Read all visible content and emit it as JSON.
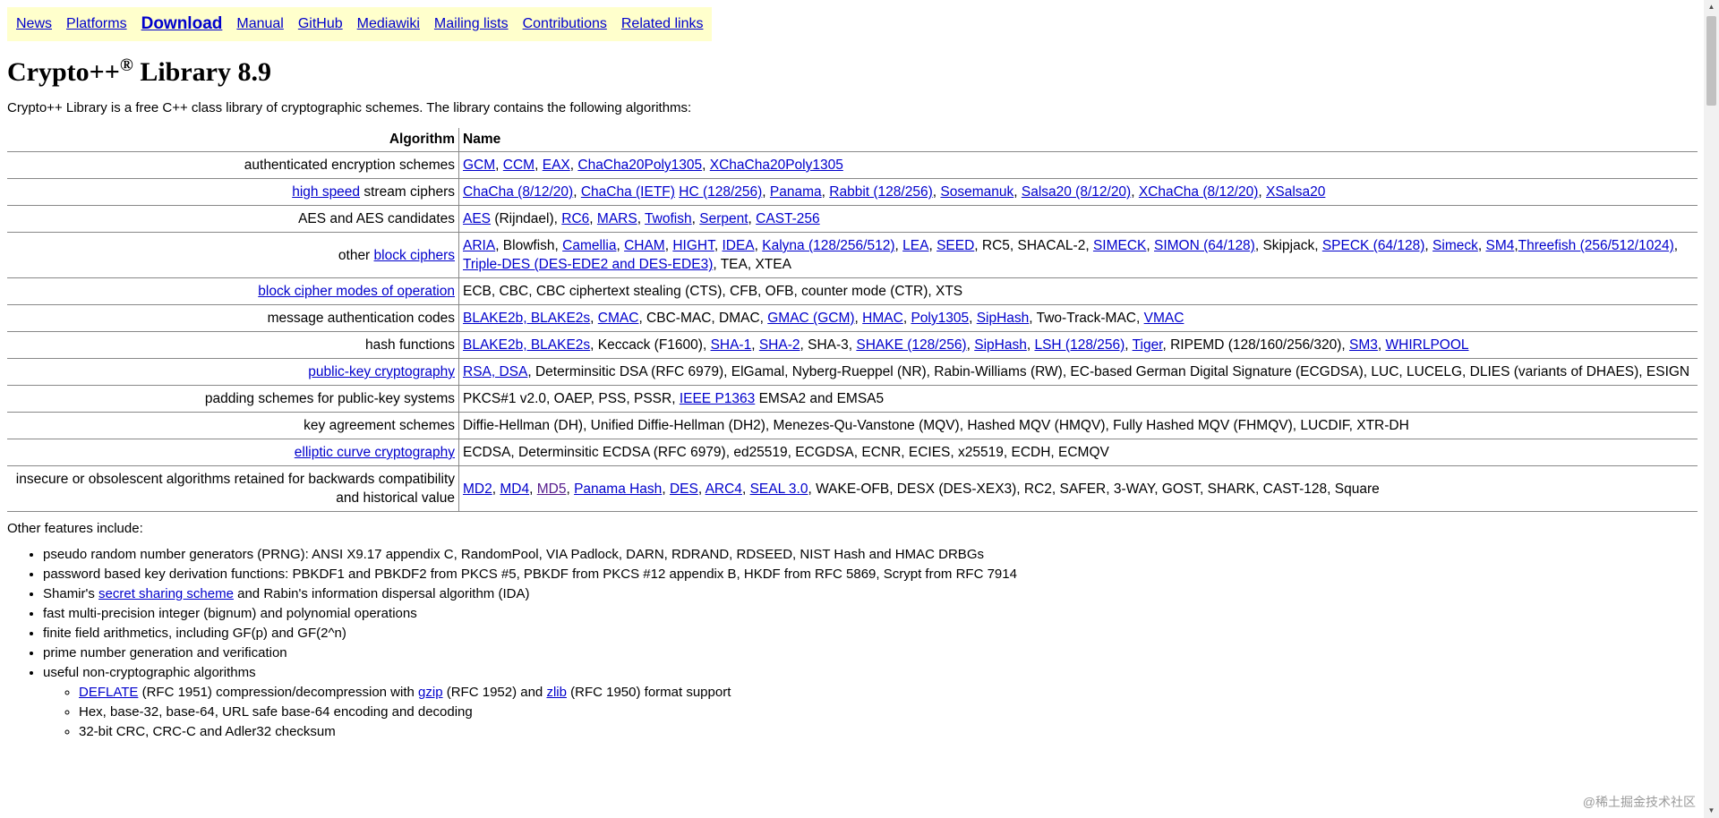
{
  "nav": [
    {
      "label": "News",
      "strong": false
    },
    {
      "label": "Platforms",
      "strong": false
    },
    {
      "label": "Download",
      "strong": true
    },
    {
      "label": "Manual",
      "strong": false
    },
    {
      "label": "GitHub",
      "strong": false
    },
    {
      "label": "Mediawiki",
      "strong": false
    },
    {
      "label": "Mailing lists",
      "strong": false
    },
    {
      "label": "Contributions",
      "strong": false
    },
    {
      "label": "Related links",
      "strong": false
    }
  ],
  "title": {
    "main": "Crypto++",
    "sup": "®",
    "suffix": " Library 8.9"
  },
  "intro": "Crypto++ Library is a free C++ class library of cryptographic schemes. The library contains the following algorithms:",
  "table": {
    "headers": [
      "Algorithm",
      "Name"
    ],
    "rows": [
      {
        "left": [
          {
            "t": "authenticated encryption schemes"
          }
        ],
        "right": [
          {
            "t": "GCM",
            "l": true
          },
          {
            "t": ", "
          },
          {
            "t": "CCM",
            "l": true
          },
          {
            "t": ", "
          },
          {
            "t": "EAX",
            "l": true
          },
          {
            "t": ", "
          },
          {
            "t": "ChaCha20Poly1305",
            "l": true
          },
          {
            "t": ", "
          },
          {
            "t": "XChaCha20Poly1305",
            "l": true
          }
        ]
      },
      {
        "left": [
          {
            "t": "high speed",
            "l": true
          },
          {
            "t": " stream ciphers"
          }
        ],
        "right": [
          {
            "t": "ChaCha (8/12/20)",
            "l": true
          },
          {
            "t": ", "
          },
          {
            "t": "ChaCha (IETF)",
            "l": true
          },
          {
            "t": " "
          },
          {
            "t": "HC (128/256)",
            "l": true
          },
          {
            "t": ", "
          },
          {
            "t": "Panama",
            "l": true
          },
          {
            "t": ", "
          },
          {
            "t": "Rabbit (128/256)",
            "l": true
          },
          {
            "t": ", "
          },
          {
            "t": "Sosemanuk",
            "l": true
          },
          {
            "t": ", "
          },
          {
            "t": "Salsa20 (8/12/20)",
            "l": true
          },
          {
            "t": ", "
          },
          {
            "t": "XChaCha (8/12/20)",
            "l": true
          },
          {
            "t": ", "
          },
          {
            "t": "XSalsa20",
            "l": true
          }
        ]
      },
      {
        "left": [
          {
            "t": "AES and AES candidates"
          }
        ],
        "right": [
          {
            "t": "AES",
            "l": true
          },
          {
            "t": " (Rijndael), "
          },
          {
            "t": "RC6",
            "l": true
          },
          {
            "t": ", "
          },
          {
            "t": "MARS",
            "l": true
          },
          {
            "t": ", "
          },
          {
            "t": "Twofish",
            "l": true
          },
          {
            "t": ", "
          },
          {
            "t": "Serpent",
            "l": true
          },
          {
            "t": ", "
          },
          {
            "t": "CAST-256",
            "l": true
          }
        ]
      },
      {
        "left": [
          {
            "t": "other "
          },
          {
            "t": "block ciphers",
            "l": true
          }
        ],
        "right": [
          {
            "t": "ARIA",
            "l": true
          },
          {
            "t": ", Blowfish, "
          },
          {
            "t": "Camellia",
            "l": true
          },
          {
            "t": ", "
          },
          {
            "t": "CHAM",
            "l": true
          },
          {
            "t": ", "
          },
          {
            "t": "HIGHT",
            "l": true
          },
          {
            "t": ", "
          },
          {
            "t": "IDEA",
            "l": true
          },
          {
            "t": ", "
          },
          {
            "t": "Kalyna (128/256/512)",
            "l": true
          },
          {
            "t": ", "
          },
          {
            "t": "LEA",
            "l": true
          },
          {
            "t": ", "
          },
          {
            "t": "SEED",
            "l": true
          },
          {
            "t": ", RC5, SHACAL-2, "
          },
          {
            "t": "SIMECK",
            "l": true
          },
          {
            "t": ", "
          },
          {
            "t": "SIMON (64/128)",
            "l": true
          },
          {
            "t": ", Skipjack, "
          },
          {
            "t": "SPECK (64/128)",
            "l": true
          },
          {
            "t": ", "
          },
          {
            "t": "Simeck",
            "l": true
          },
          {
            "t": ", "
          },
          {
            "t": "SM4",
            "l": true
          },
          {
            "t": ","
          },
          {
            "t": "Threefish (256/512/1024)",
            "l": true
          },
          {
            "t": ", "
          },
          {
            "t": "Triple-DES (DES-EDE2 and DES-EDE3)",
            "l": true
          },
          {
            "t": ", TEA, XTEA"
          }
        ]
      },
      {
        "left": [
          {
            "t": "block cipher modes of operation",
            "l": true
          }
        ],
        "right": [
          {
            "t": "ECB, CBC, CBC ciphertext stealing (CTS), CFB, OFB, counter mode (CTR), XTS"
          }
        ]
      },
      {
        "left": [
          {
            "t": "message authentication codes"
          }
        ],
        "right": [
          {
            "t": "BLAKE2b, BLAKE2s",
            "l": true
          },
          {
            "t": ", "
          },
          {
            "t": "CMAC",
            "l": true
          },
          {
            "t": ", CBC-MAC, DMAC, "
          },
          {
            "t": "GMAC (GCM)",
            "l": true
          },
          {
            "t": ", "
          },
          {
            "t": "HMAC",
            "l": true
          },
          {
            "t": ", "
          },
          {
            "t": "Poly1305",
            "l": true
          },
          {
            "t": ", "
          },
          {
            "t": "SipHash",
            "l": true
          },
          {
            "t": ", Two-Track-MAC, "
          },
          {
            "t": "VMAC",
            "l": true
          }
        ]
      },
      {
        "left": [
          {
            "t": "hash functions"
          }
        ],
        "right": [
          {
            "t": "BLAKE2b, BLAKE2s",
            "l": true
          },
          {
            "t": ", Keccack (F1600), "
          },
          {
            "t": "SHA-1",
            "l": true
          },
          {
            "t": ", "
          },
          {
            "t": "SHA-2",
            "l": true
          },
          {
            "t": ", SHA-3, "
          },
          {
            "t": "SHAKE (128/256)",
            "l": true
          },
          {
            "t": ", "
          },
          {
            "t": "SipHash",
            "l": true
          },
          {
            "t": ", "
          },
          {
            "t": "LSH (128/256)",
            "l": true
          },
          {
            "t": ", "
          },
          {
            "t": "Tiger",
            "l": true
          },
          {
            "t": ", RIPEMD (128/160/256/320), "
          },
          {
            "t": "SM3",
            "l": true
          },
          {
            "t": ", "
          },
          {
            "t": "WHIRLPOOL",
            "l": true
          }
        ]
      },
      {
        "left": [
          {
            "t": "public-key cryptography",
            "l": true
          }
        ],
        "right": [
          {
            "t": "RSA, DSA",
            "l": true
          },
          {
            "t": ", Determinsitic DSA (RFC 6979), ElGamal, Nyberg-Rueppel (NR), Rabin-Williams (RW), EC-based German Digital Signature (ECGDSA), LUC, LUCELG, DLIES (variants of DHAES), ESIGN"
          }
        ]
      },
      {
        "left": [
          {
            "t": "padding schemes for public-key systems"
          }
        ],
        "right": [
          {
            "t": "PKCS#1 v2.0, OAEP, PSS, PSSR, "
          },
          {
            "t": "IEEE P1363",
            "l": true
          },
          {
            "t": " EMSA2 and EMSA5"
          }
        ]
      },
      {
        "left": [
          {
            "t": "key agreement schemes"
          }
        ],
        "right": [
          {
            "t": "Diffie-Hellman (DH), Unified Diffie-Hellman (DH2), Menezes-Qu-Vanstone (MQV), Hashed MQV (HMQV), Fully Hashed MQV (FHMQV), LUCDIF, XTR-DH"
          }
        ]
      },
      {
        "left": [
          {
            "t": "elliptic curve cryptography",
            "l": true
          }
        ],
        "right": [
          {
            "t": "ECDSA, Determinsitic ECDSA (RFC 6979), ed25519, ECGDSA, ECNR, ECIES, x25519, ECDH, ECMQV"
          }
        ]
      },
      {
        "left": [
          {
            "t": "insecure or obsolescent algorithms retained for backwards compatibility and historical value"
          }
        ],
        "right": [
          {
            "t": "MD2",
            "l": true
          },
          {
            "t": ", "
          },
          {
            "t": "MD4",
            "l": true
          },
          {
            "t": ", "
          },
          {
            "t": "MD5",
            "l": true,
            "v": true
          },
          {
            "t": ", "
          },
          {
            "t": "Panama Hash",
            "l": true
          },
          {
            "t": ", "
          },
          {
            "t": "DES",
            "l": true
          },
          {
            "t": ", "
          },
          {
            "t": "ARC4",
            "l": true
          },
          {
            "t": ", "
          },
          {
            "t": "SEAL 3.0",
            "l": true
          },
          {
            "t": ", WAKE-OFB, DESX (DES-XEX3), RC2, SAFER, 3-WAY, GOST, SHARK, CAST-128, Square"
          }
        ]
      }
    ]
  },
  "other_features_label": "Other features include:",
  "features": [
    [
      {
        "t": "pseudo random number generators (PRNG): ANSI X9.17 appendix C, RandomPool, VIA Padlock, DARN, RDRAND, RDSEED, NIST Hash and HMAC DRBGs"
      }
    ],
    [
      {
        "t": "password based key derivation functions: PBKDF1 and PBKDF2 from PKCS #5, PBKDF from PKCS #12 appendix B, HKDF from RFC 5869, Scrypt from RFC 7914"
      }
    ],
    [
      {
        "t": "Shamir's "
      },
      {
        "t": "secret sharing scheme",
        "l": true
      },
      {
        "t": " and Rabin's information dispersal algorithm (IDA)"
      }
    ],
    [
      {
        "t": "fast multi-precision integer (bignum) and polynomial operations"
      }
    ],
    [
      {
        "t": "finite field arithmetics, including GF(p) and GF(2^n)"
      }
    ],
    [
      {
        "t": "prime number generation and verification"
      }
    ],
    [
      {
        "t": "useful non-cryptographic algorithms"
      }
    ]
  ],
  "subfeatures": [
    [
      {
        "t": "DEFLATE",
        "l": true
      },
      {
        "t": " (RFC 1951) compression/decompression with "
      },
      {
        "t": "gzip",
        "l": true
      },
      {
        "t": " (RFC 1952) and "
      },
      {
        "t": "zlib",
        "l": true
      },
      {
        "t": " (RFC 1950) format support"
      }
    ],
    [
      {
        "t": "Hex, base-32, base-64, URL safe base-64 encoding and decoding"
      }
    ],
    [
      {
        "t": "32-bit CRC, CRC-C and Adler32 checksum"
      }
    ]
  ],
  "watermark": "@稀土掘金技术社区",
  "colors": {
    "nav_bg": "#ffffcc",
    "link": "#0000cc",
    "visited": "#551a8b"
  }
}
